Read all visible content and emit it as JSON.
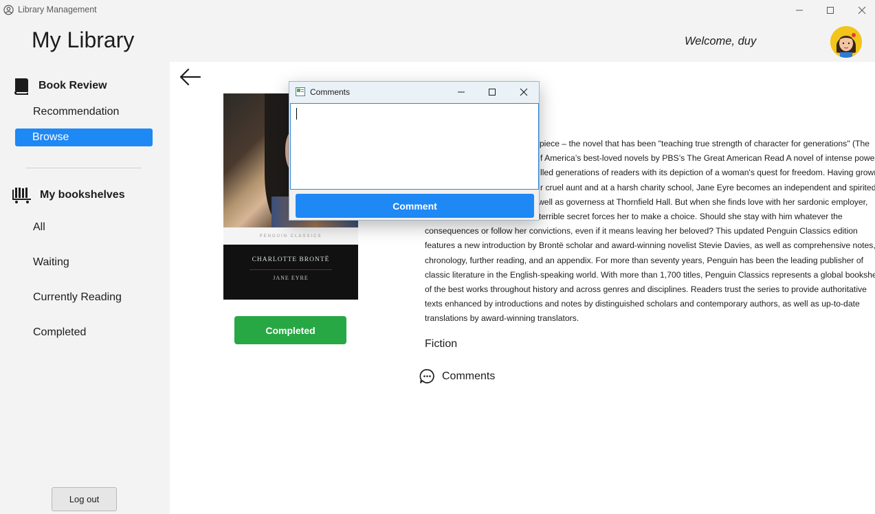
{
  "window": {
    "title": "Library Management",
    "controls": [
      "minimize",
      "maximize",
      "close"
    ]
  },
  "header": {
    "title": "My Library",
    "welcome": "Welcome, duy"
  },
  "sidebar": {
    "book_review_label": "Book Review",
    "book_review_items": [
      {
        "label": "Recommendation",
        "active": false
      },
      {
        "label": "Browse",
        "active": true
      }
    ],
    "bookshelves_label": "My bookshelves",
    "bookshelf_items": [
      {
        "label": "All"
      },
      {
        "label": "Waiting"
      },
      {
        "label": "Currently Reading"
      },
      {
        "label": "Completed"
      }
    ],
    "logout_label": "Log out"
  },
  "book": {
    "cover": {
      "publisher_band": "PENGUIN CLASSICS",
      "author": "CHARLOTTE BRONTË",
      "title": "JANE EYRE"
    },
    "status_label": "Completed",
    "description_lines": [
      "erpiece – the novel that has been \"teaching true strength of character for generations\" (The",
      "f America’s best-loved novels by PBS’s The Great American Read A novel of intense power",
      "lled generations of readers with its depiction of a woman's quest for freedom. Having grown",
      "r cruel aunt and at a harsh charity school, Jane Eyre becomes an independent and spirited",
      " well as governess at Thornfield Hall. But when she finds love with her sardonic employer,",
      "terrible secret forces her to make a choice. Should she stay with him whatever the",
      "consequences or follow her convictions, even if it means leaving her beloved? This updated Penguin Classics edition",
      "features a new introduction by Brontë scholar and award-winning novelist Stevie Davies, as well as comprehensive notes, a",
      "chronology, further reading, and an appendix. For more than seventy years, Penguin has been the leading publisher of",
      "classic literature in the English-speaking world. With more than 1,700 titles, Penguin Classics represents a global bookshelf",
      "of the best works throughout history and across genres and disciplines. Readers trust the series to provide authoritative",
      "texts enhanced by introductions and notes by distinguished scholars and contemporary authors, as well as up-to-date",
      "translations by award-winning translators."
    ],
    "genre": "Fiction",
    "comments_link": "Comments"
  },
  "dialog": {
    "title": "Comments",
    "textbox_value": "",
    "submit_label": "Comment"
  },
  "colors": {
    "accent": "#1e88f5",
    "success": "#28a745",
    "sidebar_bg": "#f3f3f3"
  }
}
